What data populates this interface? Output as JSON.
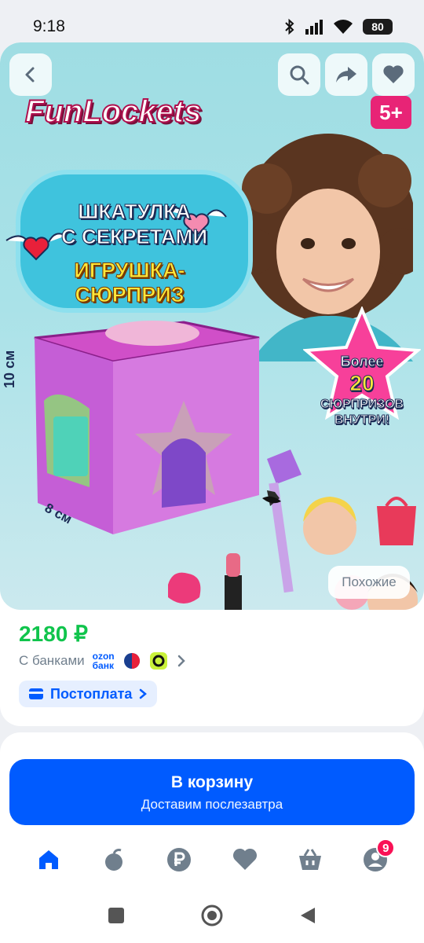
{
  "status_bar": {
    "time": "9:18",
    "battery": "80",
    "icons": [
      "bluetooth-icon",
      "signal-icon",
      "wifi-icon",
      "battery-icon"
    ]
  },
  "product_image": {
    "brand": "FunLockets",
    "age": "5+",
    "title_line1": "ШКАТУЛКА",
    "title_line2": "С СЕКРЕТАМИ",
    "subtitle": "ИГРУШКА-СЮРПРИЗ",
    "star_line1": "Более",
    "star_line2": "20",
    "star_line3": "СЮРПРИЗОВ",
    "star_line4": "ВНУТРИ!",
    "dim_height": "10 см",
    "dim_width": "8 см",
    "similar_label": "Похожие"
  },
  "header_actions": [
    "back-icon",
    "search-icon",
    "share-icon",
    "heart-icon"
  ],
  "price": "2180 ₽",
  "banks": {
    "label": "С банками",
    "ozon_bank_line1": "ozon",
    "ozon_bank_line2": "банк"
  },
  "postpay": {
    "label": "Постоплата"
  },
  "cart": {
    "main": "В корзину",
    "sub": "Доставим послезавтра"
  },
  "bottom_nav": {
    "items": [
      "home-icon",
      "fresh-icon",
      "ruble-icon",
      "heart-icon",
      "basket-icon",
      "profile-icon"
    ],
    "profile_badge": "9"
  },
  "colors": {
    "accent": "#005bff",
    "price": "#10c44c",
    "badge": "#f91155"
  }
}
